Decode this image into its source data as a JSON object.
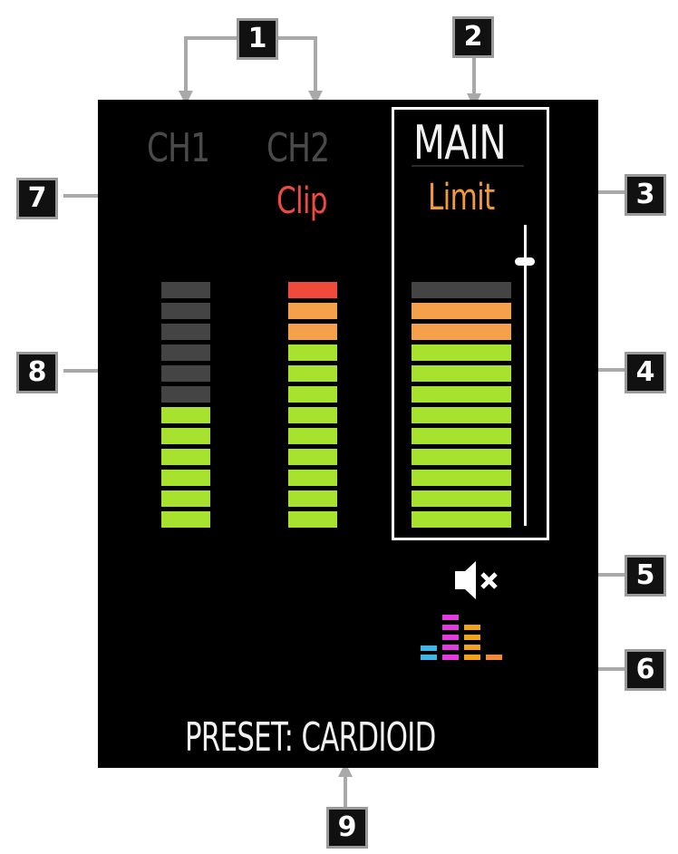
{
  "screen": {
    "channels": [
      {
        "label": "CH1",
        "status": "",
        "status_color": "",
        "meter_lit": 6,
        "meter_levels": [
          "green",
          "green",
          "green",
          "green",
          "green",
          "green",
          "gray",
          "gray",
          "gray",
          "gray",
          "gray",
          "gray"
        ]
      },
      {
        "label": "CH2",
        "status": "Clip",
        "status_color": "#f04a3c",
        "meter_lit": 12,
        "meter_levels": [
          "green",
          "green",
          "green",
          "green",
          "green",
          "green",
          "green",
          "green",
          "green",
          "orange",
          "orange",
          "red"
        ]
      }
    ],
    "main": {
      "label": "MAIN",
      "status": "Limit",
      "status_color": "#f39a37",
      "meter_levels": [
        "green",
        "green",
        "green",
        "green",
        "green",
        "green",
        "green",
        "green",
        "green",
        "orange",
        "orange",
        "gray"
      ],
      "fader_level": 0.88,
      "mute_icon": "speaker-mute-icon",
      "eq_icon": "eq-bars-icon"
    },
    "preset_text": "PRESET: CARDIOID"
  },
  "colors": {
    "green": "#a6e22e",
    "orange": "#f5a04a",
    "red": "#f04a3c",
    "gray": "#444444",
    "label_dim": "#4a4a4a",
    "label_bright": "#f2f2f2",
    "callout_bg": "#111111",
    "callout_border": "#9a9a9a"
  },
  "callouts": [
    "1",
    "2",
    "3",
    "4",
    "5",
    "6",
    "7",
    "8",
    "9"
  ]
}
